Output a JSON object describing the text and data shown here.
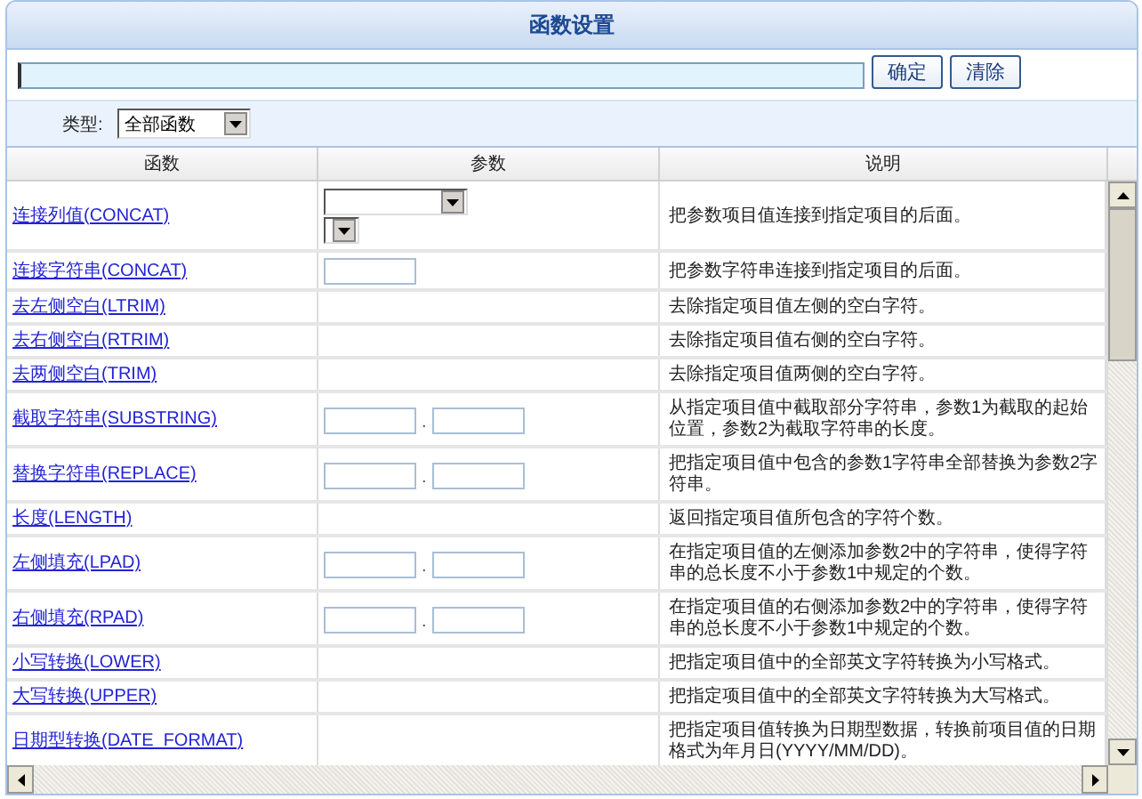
{
  "panel": {
    "title": "函数设置"
  },
  "expression": {
    "buttons": [
      "确定",
      "清除"
    ]
  },
  "type_filter": {
    "label": "类型:",
    "value": "全部函数"
  },
  "table": {
    "columns": [
      "函数",
      "参数",
      "说明"
    ],
    "rows": [
      {
        "function": "连接列值(CONCAT)",
        "params": {
          "kind": "selects"
        },
        "description": "把参数项目值连接到指定项目的后面。"
      },
      {
        "function": "连接字符串(CONCAT)",
        "params": {
          "kind": "text"
        },
        "description": "把参数字符串连接到指定项目的后面。"
      },
      {
        "function": "去左侧空白(LTRIM)",
        "params": {
          "kind": "none"
        },
        "description": "去除指定项目值左侧的空白字符。"
      },
      {
        "function": "去右侧空白(RTRIM)",
        "params": {
          "kind": "none"
        },
        "description": "去除指定项目值右侧的空白字符。"
      },
      {
        "function": "去两侧空白(TRIM)",
        "params": {
          "kind": "none"
        },
        "description": "去除指定项目值两侧的空白字符。"
      },
      {
        "function": "截取字符串(SUBSTRING)",
        "params": {
          "kind": "pair",
          "separator": "."
        },
        "description": "从指定项目值中截取部分字符串，参数1为截取的起始位置，参数2为截取字符串的长度。"
      },
      {
        "function": "替换字符串(REPLACE)",
        "params": {
          "kind": "pair",
          "separator": "."
        },
        "description": "把指定项目值中包含的参数1字符串全部替换为参数2字符串。"
      },
      {
        "function": "长度(LENGTH)",
        "params": {
          "kind": "none"
        },
        "description": "返回指定项目值所包含的字符个数。"
      },
      {
        "function": "左侧填充(LPAD)",
        "params": {
          "kind": "pair",
          "separator": "."
        },
        "description": "在指定项目值的左侧添加参数2中的字符串，使得字符串的总长度不小于参数1中规定的个数。"
      },
      {
        "function": "右侧填充(RPAD)",
        "params": {
          "kind": "pair",
          "separator": "."
        },
        "description": "在指定项目值的右侧添加参数2中的字符串，使得字符串的总长度不小于参数1中规定的个数。"
      },
      {
        "function": "小写转换(LOWER)",
        "params": {
          "kind": "none"
        },
        "description": "把指定项目值中的全部英文字符转换为小写格式。"
      },
      {
        "function": "大写转换(UPPER)",
        "params": {
          "kind": "none"
        },
        "description": "把指定项目值中的全部英文字符转换为大写格式。"
      },
      {
        "function": "日期型转换(DATE_FORMAT)",
        "params": {
          "kind": "none"
        },
        "description": "把指定项目值转换为日期型数据，转换前项目值的日期格式为年月日(YYYY/MM/DD)。"
      }
    ]
  }
}
